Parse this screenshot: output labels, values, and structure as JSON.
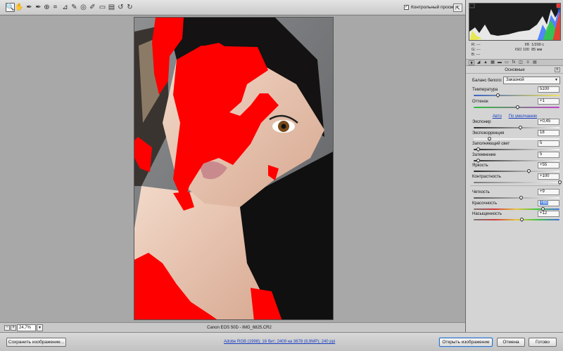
{
  "toolbar": {
    "tools": [
      {
        "name": "zoom-tool-icon",
        "glyph": "🔍"
      },
      {
        "name": "hand-tool-icon",
        "glyph": "✋"
      },
      {
        "name": "white-balance-tool-icon",
        "glyph": "✒"
      },
      {
        "name": "color-sampler-tool-icon",
        "glyph": "✒"
      },
      {
        "name": "targeted-adjustment-tool-icon",
        "glyph": "⊕"
      },
      {
        "name": "crop-tool-icon",
        "glyph": "⌗"
      },
      {
        "name": "straighten-tool-icon",
        "glyph": "⊿"
      },
      {
        "name": "spot-removal-tool-icon",
        "glyph": "✎"
      },
      {
        "name": "red-eye-tool-icon",
        "glyph": "◎"
      },
      {
        "name": "adjustment-brush-icon",
        "glyph": "✐"
      },
      {
        "name": "graduated-filter-icon",
        "glyph": "▭"
      },
      {
        "name": "preferences-icon",
        "glyph": "▤"
      },
      {
        "name": "rotate-ccw-icon",
        "glyph": "↺"
      },
      {
        "name": "rotate-cw-icon",
        "glyph": "↻"
      }
    ],
    "preview_label": "Контрольный просмотр",
    "preview_checked": true
  },
  "zoom": {
    "value": "24,7%"
  },
  "file": {
    "name": "Canon EOS 50D  -  IMG_6825.CR2"
  },
  "histogram_readout": {
    "r_label": "R:",
    "g_label": "G:",
    "b_label": "B:",
    "r_value": "---",
    "g_value": "---",
    "b_value": "---",
    "aperture": "f/8",
    "shutter": "1/200 с",
    "iso": "ISO 100",
    "focal": "85 мм"
  },
  "panel": {
    "section_title": "Основные",
    "white_balance_label": "Баланс белого:",
    "white_balance_value": "Заказной",
    "auto_link": "Авто",
    "default_link": "По умолчанию",
    "sliders_top": [
      {
        "key": "temperature",
        "label": "Температура",
        "value": "5100",
        "level": 0.28,
        "track": "linear-gradient(90deg,#3a62c8,#f3e45a)"
      },
      {
        "key": "tint",
        "label": "Оттенок",
        "value": "+1",
        "level": 0.51,
        "track": "linear-gradient(90deg,#2dbf3a,#c53fd0)"
      }
    ],
    "sliders_mid": [
      {
        "key": "exposure",
        "label": "Экспонир",
        "value": "+0,45",
        "level": 0.54,
        "track": "linear-gradient(90deg,#2a2a2a,#f4f4f4)"
      },
      {
        "key": "recovery",
        "label": "Экспокоррекция",
        "value": "18",
        "level": 0.18,
        "track": "linear-gradient(90deg,#f4f4f4,#f4f4f4)"
      },
      {
        "key": "fill-light",
        "label": "Заполняющий свет",
        "value": "5",
        "level": 0.05,
        "track": "linear-gradient(90deg,#2a2a2a,#f4f4f4)"
      },
      {
        "key": "blacks",
        "label": "Затемнение",
        "value": "5",
        "level": 0.05,
        "track": "linear-gradient(90deg,#2a2a2a,#f4f4f4)"
      },
      {
        "key": "brightness",
        "label": "Яркость",
        "value": "+55",
        "level": 0.64,
        "track": "linear-gradient(90deg,#2a2a2a,#f4f4f4)"
      },
      {
        "key": "contrast",
        "label": "Контрастность",
        "value": "+100",
        "level": 1.0,
        "track": "linear-gradient(90deg,#777,#f4f4f4)"
      }
    ],
    "sliders_bottom": [
      {
        "key": "clarity",
        "label": "Четкость",
        "value": "+9",
        "level": 0.55,
        "track": "linear-gradient(90deg,#555,#f4f4f4)"
      },
      {
        "key": "vibrance",
        "label": "Красочность",
        "value": "+60",
        "level": 0.8,
        "track": "linear-gradient(90deg,#777,#d23c3c,#e6c43c,#3cc43c,#3c6ce6)",
        "selected": true
      },
      {
        "key": "saturation",
        "label": "Насыщенность",
        "value": "+12",
        "level": 0.56,
        "track": "linear-gradient(90deg,#777,#d23c3c,#e6c43c,#3cc43c,#3c6ce6)"
      }
    ]
  },
  "footer": {
    "save_label": "Сохранить изображение...",
    "workflow_link": "Adobe RGB (1998); 16 бит; 2409 на 3678 (8,9МР); 240 ppi",
    "open_label": "Открыть изображение",
    "cancel_label": "Отмена",
    "done_label": "Готово"
  }
}
